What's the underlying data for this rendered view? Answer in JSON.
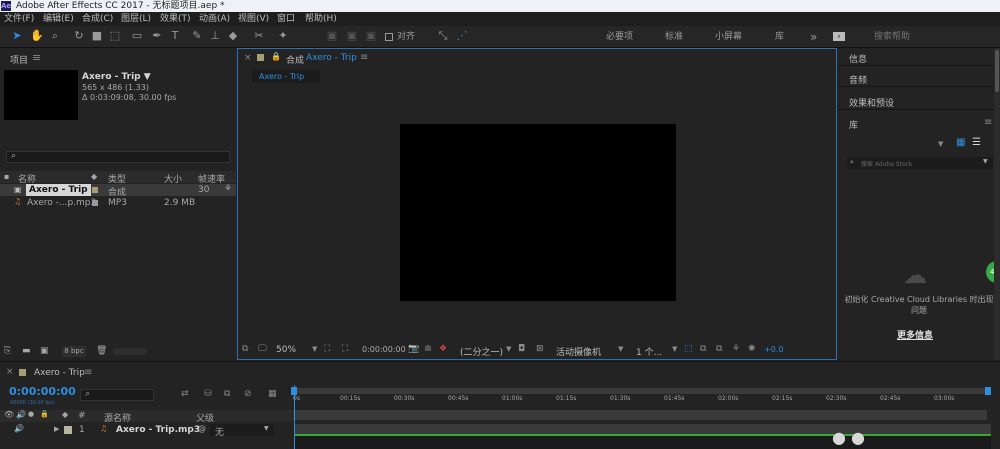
{
  "window": {
    "title": "Adobe After Effects CC 2017 - 无标题项目.aep *",
    "logo": "Ae"
  },
  "menu": [
    "文件(F)",
    "编辑(E)",
    "合成(C)",
    "图层(L)",
    "效果(T)",
    "动画(A)",
    "视图(V)",
    "窗口",
    "帮助(H)"
  ],
  "toolbar": {
    "snap_label": "对齐",
    "workspaces": [
      "必要项",
      "标准",
      "小屏幕",
      "库"
    ],
    "more": "»",
    "search_placeholder": "搜索帮助"
  },
  "project": {
    "panel_title": "项目",
    "menu_icon": "≡",
    "comp_name": "Axero - Trip ▼",
    "comp_size": "565 x 486 (1.33)",
    "comp_duration": "Δ 0:03:09:08, 30.00 fps",
    "columns": [
      "名称",
      "类型",
      "大小",
      "帧速率"
    ],
    "items": [
      {
        "name": "Axero - Trip",
        "type": "合成",
        "size": "",
        "fps": "30"
      },
      {
        "name": "Axero -...p.mp3",
        "type": "MP3",
        "size": "2.9 MB",
        "fps": ""
      }
    ],
    "bpc": "8 bpc"
  },
  "composition": {
    "panel_prefix": "合成",
    "panel_name": "Axero - Trip",
    "tab": "Axero - Trip",
    "zoom": "50%",
    "timecode": "0:00:00:00",
    "resolution": "(二分之一)",
    "camera": "活动摄像机",
    "views": "1 个...",
    "exposure": "+0.0"
  },
  "right_panel": {
    "sections": [
      "信息",
      "音频",
      "效果和预设"
    ],
    "library_title": "库",
    "library_search": "搜索 Adobe Stock",
    "cc_message": "初始化 Creative Cloud Libraries 时出现问题",
    "more_info": "更多信息",
    "badge": "41"
  },
  "timeline": {
    "tab": "Axero - Trip",
    "timecode": "0:00:00:00",
    "timecode_sub": "00000 (30.00 fps)",
    "header_source": "源名称",
    "header_parent": "父级",
    "layer_num": "1",
    "layer_name": "Axero - Trip.mp3",
    "parent_value": "无",
    "ruler_labels": [
      "0s",
      "00:15s",
      "00:30s",
      "00:45s",
      "01:00s",
      "01:15s",
      "01:30s",
      "01:45s",
      "02:00s",
      "02:15s",
      "02:30s",
      "02:45s",
      "03:00s"
    ]
  },
  "colors": {
    "accent": "#2f8ee0",
    "track": "#3aa63a",
    "panel": "#232323",
    "frame": "#000000"
  }
}
